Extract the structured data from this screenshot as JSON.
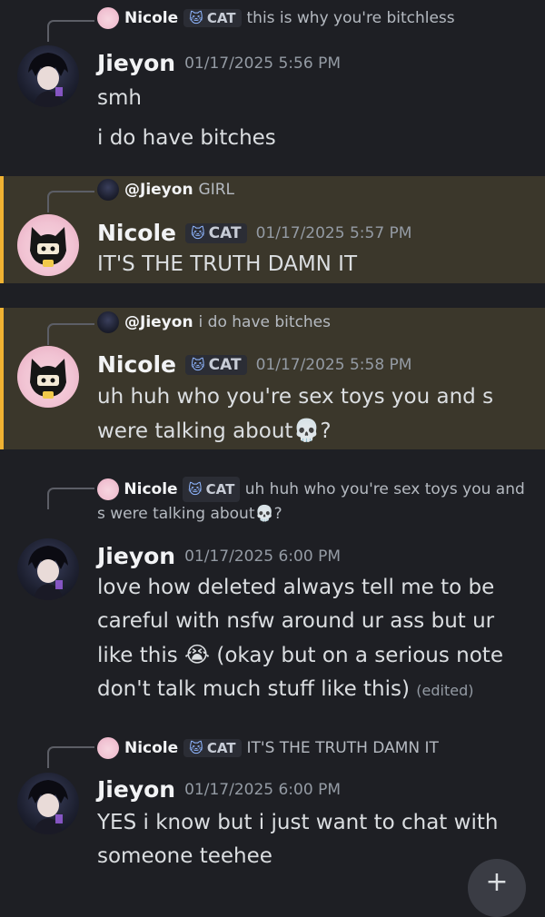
{
  "messages": [
    {
      "reply": {
        "author": "Nicole",
        "tag": "CAT",
        "content": "this is why you're bitchless"
      },
      "author": "Jieyon",
      "timestamp": "01/17/2025 5:56 PM",
      "lines": [
        "smh",
        "i do have bitches"
      ]
    },
    {
      "reply": {
        "author": "@Jieyon",
        "content": "GIRL"
      },
      "author": "Nicole",
      "tag": "CAT",
      "timestamp": "01/17/2025 5:57 PM",
      "text": "IT'S THE TRUTH DAMN IT"
    },
    {
      "reply": {
        "author": "@Jieyon",
        "content": "i do have bitches"
      },
      "author": "Nicole",
      "tag": "CAT",
      "timestamp": "01/17/2025 5:58 PM",
      "text_before": "uh huh who you're sex toys you and s were talking about",
      "text_after": "?"
    },
    {
      "reply": {
        "author": "Nicole",
        "tag": "CAT",
        "content_before": "uh huh who you're sex toys you and s were talking about",
        "content_after": "?"
      },
      "author": "Jieyon",
      "timestamp": "01/17/2025 6:00 PM",
      "text_before": "love how deleted always tell me to be careful with nsfw around ur ass but ur like this",
      "text_after": "(okay but on a serious note don't talk much stuff like this)",
      "edited": "(edited)"
    },
    {
      "reply": {
        "author": "Nicole",
        "tag": "CAT",
        "content": "IT'S THE TRUTH DAMN IT"
      },
      "author": "Jieyon",
      "timestamp": "01/17/2025 6:00 PM",
      "text": "YES i know but i just want to chat with someone teehee"
    }
  ],
  "colors": {
    "background": "#1e1f24",
    "highlight": "#3b372b",
    "highlight_bar": "#f0b232"
  },
  "icons": {
    "cat_tag": "cat-face-icon",
    "skull": "skull-emoji",
    "crying": "loudly-crying-face-emoji"
  }
}
